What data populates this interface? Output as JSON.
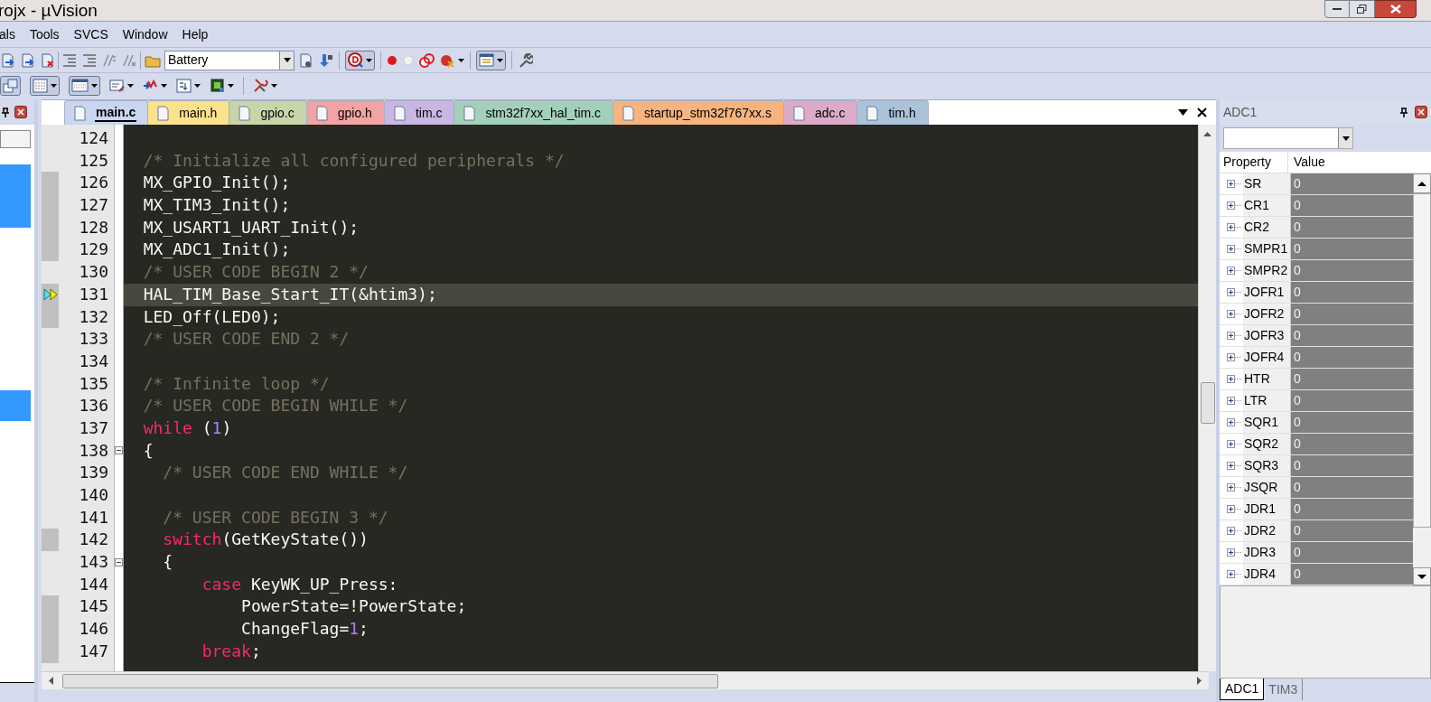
{
  "window": {
    "title": "rojx - µVision"
  },
  "menu": [
    "als",
    "Tools",
    "SVCS",
    "Window",
    "Help"
  ],
  "toolbar": {
    "target": "Battery"
  },
  "tabs": [
    {
      "label": "main.c",
      "selected": true,
      "color": "#c9d6ef"
    },
    {
      "label": "main.h",
      "selected": false,
      "color": "#fde28c"
    },
    {
      "label": "gpio.c",
      "selected": false,
      "color": "#c8d5a8"
    },
    {
      "label": "gpio.h",
      "selected": false,
      "color": "#f2a3a3"
    },
    {
      "label": "tim.c",
      "selected": false,
      "color": "#c9b6e2"
    },
    {
      "label": "stm32f7xx_hal_tim.c",
      "selected": false,
      "color": "#a3d0bb"
    },
    {
      "label": "startup_stm32f767xx.s",
      "selected": false,
      "color": "#f7b47e"
    },
    {
      "label": "adc.c",
      "selected": false,
      "color": "#dcabc9"
    },
    {
      "label": "tim.h",
      "selected": false,
      "color": "#abc3da"
    }
  ],
  "editor": {
    "lines": [
      {
        "number": "124",
        "executed": false,
        "current": false,
        "fold": false
      },
      {
        "number": "125",
        "executed": false,
        "current": false,
        "fold": false,
        "tokens": [
          {
            "kind": "comment",
            "text": "  /* Initialize all configured peripherals */"
          }
        ]
      },
      {
        "number": "126",
        "executed": true,
        "current": false,
        "fold": false,
        "tokens": [
          {
            "kind": "plain",
            "text": "  MX_GPIO_Init();"
          }
        ]
      },
      {
        "number": "127",
        "executed": true,
        "current": false,
        "fold": false,
        "tokens": [
          {
            "kind": "plain",
            "text": "  MX_TIM3_Init();"
          }
        ]
      },
      {
        "number": "128",
        "executed": true,
        "current": false,
        "fold": false,
        "tokens": [
          {
            "kind": "plain",
            "text": "  MX_USART1_UART_Init();"
          }
        ]
      },
      {
        "number": "129",
        "executed": true,
        "current": false,
        "fold": false,
        "tokens": [
          {
            "kind": "plain",
            "text": "  MX_ADC1_Init();"
          }
        ]
      },
      {
        "number": "130",
        "executed": false,
        "current": false,
        "fold": false,
        "tokens": [
          {
            "kind": "comment",
            "text": "  /* USER CODE BEGIN 2 */"
          }
        ]
      },
      {
        "number": "131",
        "executed": true,
        "current": true,
        "fold": false,
        "tokens": [
          {
            "kind": "plain",
            "text": "  HAL_TIM_Base_Start_IT(&htim3);"
          }
        ]
      },
      {
        "number": "132",
        "executed": true,
        "current": false,
        "fold": false,
        "tokens": [
          {
            "kind": "plain",
            "text": "  LED_Off(LED0);"
          }
        ]
      },
      {
        "number": "133",
        "executed": false,
        "current": false,
        "fold": false,
        "tokens": [
          {
            "kind": "comment",
            "text": "  /* USER CODE END 2 */"
          }
        ]
      },
      {
        "number": "134",
        "executed": false,
        "current": false,
        "fold": false
      },
      {
        "number": "135",
        "executed": false,
        "current": false,
        "fold": false,
        "tokens": [
          {
            "kind": "comment",
            "text": "  /* Infinite loop */"
          }
        ]
      },
      {
        "number": "136",
        "executed": false,
        "current": false,
        "fold": false,
        "tokens": [
          {
            "kind": "comment",
            "text": "  /* USER CODE BEGIN WHILE */"
          }
        ]
      },
      {
        "number": "137",
        "executed": false,
        "current": false,
        "fold": false,
        "tokens": [
          {
            "kind": "keyword",
            "text": "  while"
          },
          {
            "kind": "plain",
            "text": " ("
          },
          {
            "kind": "number",
            "text": "1"
          },
          {
            "kind": "plain",
            "text": ")"
          }
        ]
      },
      {
        "number": "138",
        "executed": false,
        "current": false,
        "fold": true,
        "tokens": [
          {
            "kind": "plain",
            "text": "  {"
          }
        ]
      },
      {
        "number": "139",
        "executed": false,
        "current": false,
        "fold": false,
        "tokens": [
          {
            "kind": "comment",
            "text": "    /* USER CODE END WHILE */"
          }
        ]
      },
      {
        "number": "140",
        "executed": false,
        "current": false,
        "fold": false
      },
      {
        "number": "141",
        "executed": false,
        "current": false,
        "fold": false,
        "tokens": [
          {
            "kind": "comment",
            "text": "    /* USER CODE BEGIN 3 */"
          }
        ]
      },
      {
        "number": "142",
        "executed": true,
        "current": false,
        "fold": false,
        "tokens": [
          {
            "kind": "keyword",
            "text": "    switch"
          },
          {
            "kind": "plain",
            "text": "(GetKeyState())"
          }
        ]
      },
      {
        "number": "143",
        "executed": false,
        "current": false,
        "fold": true,
        "tokens": [
          {
            "kind": "plain",
            "text": "    {"
          }
        ]
      },
      {
        "number": "144",
        "executed": false,
        "current": false,
        "fold": false,
        "tokens": [
          {
            "kind": "keyword",
            "text": "        case"
          },
          {
            "kind": "plain",
            "text": " KeyWK_UP_Press:"
          }
        ]
      },
      {
        "number": "145",
        "executed": true,
        "current": false,
        "fold": false,
        "tokens": [
          {
            "kind": "plain",
            "text": "            PowerState=!PowerState;"
          }
        ]
      },
      {
        "number": "146",
        "executed": true,
        "current": false,
        "fold": false,
        "tokens": [
          {
            "kind": "plain",
            "text": "            ChangeFlag="
          },
          {
            "kind": "number",
            "text": "1"
          },
          {
            "kind": "plain",
            "text": ";"
          }
        ]
      },
      {
        "number": "147",
        "executed": true,
        "current": false,
        "fold": false,
        "tokens": [
          {
            "kind": "keyword",
            "text": "        break"
          },
          {
            "kind": "plain",
            "text": ";"
          }
        ]
      }
    ]
  },
  "peripheral_panel": {
    "title": "ADC1",
    "columns": [
      "Property",
      "Value"
    ],
    "registers": [
      {
        "name": "SR",
        "value": "0"
      },
      {
        "name": "CR1",
        "value": "0"
      },
      {
        "name": "CR2",
        "value": "0"
      },
      {
        "name": "SMPR1",
        "value": "0"
      },
      {
        "name": "SMPR2",
        "value": "0"
      },
      {
        "name": "JOFR1",
        "value": "0"
      },
      {
        "name": "JOFR2",
        "value": "0"
      },
      {
        "name": "JOFR3",
        "value": "0"
      },
      {
        "name": "JOFR4",
        "value": "0"
      },
      {
        "name": "HTR",
        "value": "0"
      },
      {
        "name": "LTR",
        "value": "0"
      },
      {
        "name": "SQR1",
        "value": "0"
      },
      {
        "name": "SQR2",
        "value": "0"
      },
      {
        "name": "SQR3",
        "value": "0"
      },
      {
        "name": "JSQR",
        "value": "0"
      },
      {
        "name": "JDR1",
        "value": "0"
      },
      {
        "name": "JDR2",
        "value": "0"
      },
      {
        "name": "JDR3",
        "value": "0"
      },
      {
        "name": "JDR4",
        "value": "0"
      }
    ],
    "tabs": [
      {
        "label": "ADC1",
        "selected": true
      },
      {
        "label": "TIM3",
        "selected": false
      }
    ]
  }
}
